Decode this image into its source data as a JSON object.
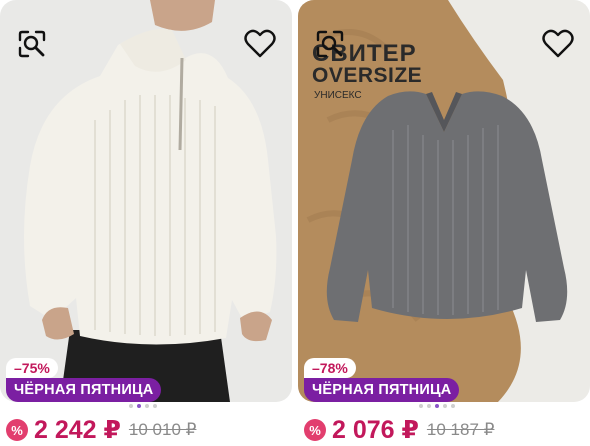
{
  "products": [
    {
      "discount": "–75%",
      "promo": "ЧЁРНАЯ ПЯТНИЦА",
      "price": "2 242 ₽",
      "old_price": "10 010 ₽",
      "price_badge_icon": "percent-icon",
      "gallery_dots": 4,
      "gallery_active_dot": 1
    },
    {
      "banner_title": "СВИТЕР",
      "banner_subtitle": "OVERSIZE",
      "banner_note": "УНИСЕКС",
      "discount": "–78%",
      "promo": "ЧЁРНАЯ ПЯТНИЦА",
      "price": "2 076 ₽",
      "old_price": "10 187 ₽",
      "price_badge_icon": "percent-icon",
      "gallery_dots": 5,
      "gallery_active_dot": 3
    }
  ],
  "colors": {
    "discount_text": "#c2185b",
    "promo_bg": "#7b1fa2",
    "price_text": "#c2185b",
    "old_price_text": "#8a8a8a",
    "active_dot": "#8a56c8"
  },
  "icons": [
    "image-search-icon",
    "heart-icon",
    "percent-icon"
  ]
}
